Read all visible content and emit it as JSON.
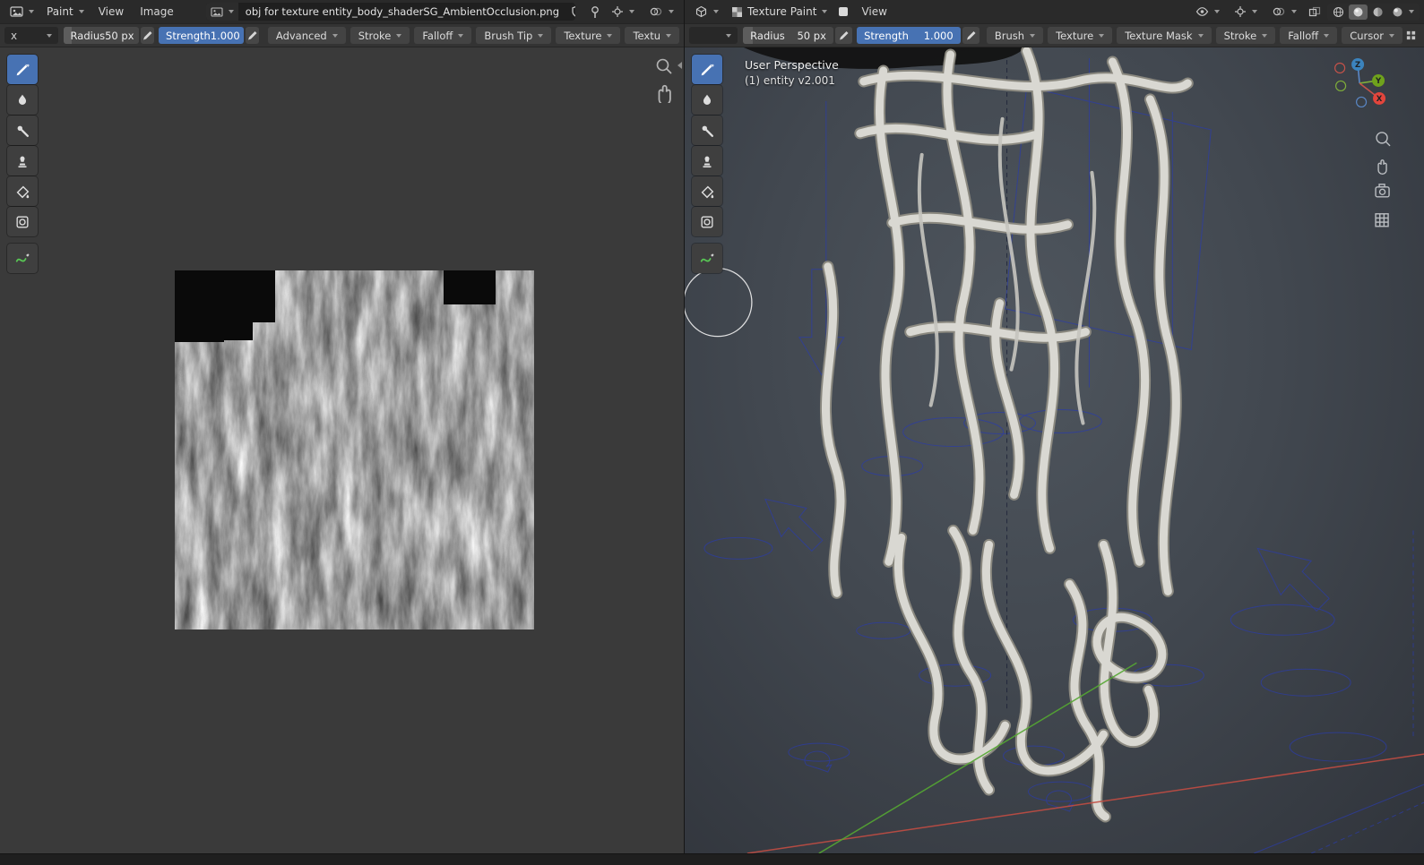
{
  "image_editor": {
    "menus": {
      "mode": "Paint",
      "view": "View",
      "image": "Image"
    },
    "id_block": {
      "image_name": "obj for texture entity_body_shaderSG_AmbientOcclusion.png"
    },
    "tool_settings": {
      "brush_selector": "x",
      "radius": {
        "label": "Radius",
        "value": "50 px"
      },
      "strength": {
        "label": "Strength",
        "value": "1.000"
      },
      "panels": [
        "Advanced",
        "Stroke",
        "Falloff",
        "Brush Tip",
        "Texture",
        "Textu"
      ]
    },
    "tools": [
      "draw",
      "soften",
      "smear",
      "clone",
      "fill",
      "mask",
      "annotate"
    ]
  },
  "viewport": {
    "menus": {
      "mode": "Texture Paint",
      "view": "View"
    },
    "tool_settings": {
      "brush_selector": "",
      "radius": {
        "label": "Radius",
        "value": "50 px"
      },
      "strength": {
        "label": "Strength",
        "value": "1.000"
      },
      "panels": [
        "Brush",
        "Texture",
        "Texture Mask",
        "Stroke",
        "Falloff",
        "Cursor"
      ]
    },
    "overlay": {
      "perspective_label": "User Perspective",
      "object_label": "(1) entity v2.001"
    },
    "gizmo_axes": {
      "x": "X",
      "y": "Y",
      "z": "Z"
    },
    "tools": [
      "draw",
      "soften",
      "smear",
      "clone",
      "fill",
      "mask",
      "annotate"
    ],
    "colors": {
      "accent": "#4772b3",
      "axis_x": "#c24d43",
      "axis_y": "#55a832",
      "axis_z": "#3b83bd",
      "wireframe": "#2b3ca8"
    }
  }
}
